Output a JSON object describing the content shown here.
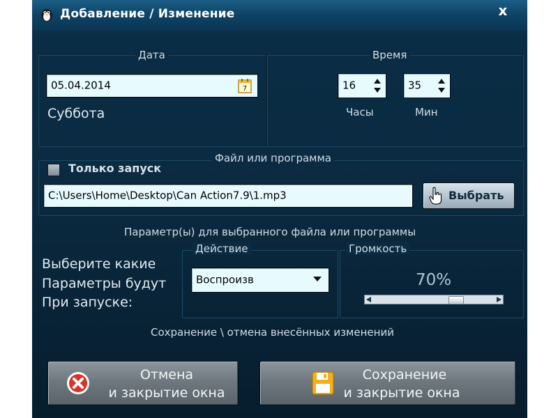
{
  "window": {
    "title": "Добавление / Изменение",
    "close_label": "x"
  },
  "date_section": {
    "label": "Дата",
    "date_value": "05.04.2014",
    "calendar_icon": "calendar-icon",
    "weekday": "Суббота"
  },
  "time_section": {
    "label": "Время",
    "hours_value": "16",
    "minutes_value": "35",
    "hours_label": "Часы",
    "minutes_label": "Мин"
  },
  "file_section": {
    "label": "Файл или программа",
    "only_launch_label": "Только запуск",
    "only_launch_checked": false,
    "path_value": "C:\\Users\\Home\\Desktop\\Can Action7.9\\1.mp3",
    "browse_label": "Выбрать",
    "browse_icon": "hand-pointer-icon"
  },
  "params_section": {
    "label": "Параметр(ы) для выбранного файла или программы",
    "prompt_lines": [
      "Выберите какие",
      "Параметры будут",
      "При запуске:"
    ],
    "action_label": "Действие",
    "action_value": "Воспроизв",
    "volume_label": "Громкость",
    "volume_text": "70%",
    "volume_level": 0.7
  },
  "save_section": {
    "label": "Сохранение \\ отмена внесённых изменений",
    "cancel_line1": "Отмена",
    "cancel_line2": "и закрытие окна",
    "cancel_icon": "close-circle-icon",
    "save_line1": "Сохранение",
    "save_line2": "и закрытие окна",
    "save_icon": "floppy-disk-icon"
  },
  "colors": {
    "window_bg": "#0b2b42",
    "titlebar": "#0f4467",
    "field_bg": "#e7fbff",
    "label_text": "#d2dde6",
    "cancel_red": "#d9342b",
    "save_yellow": "#f2b01e"
  }
}
